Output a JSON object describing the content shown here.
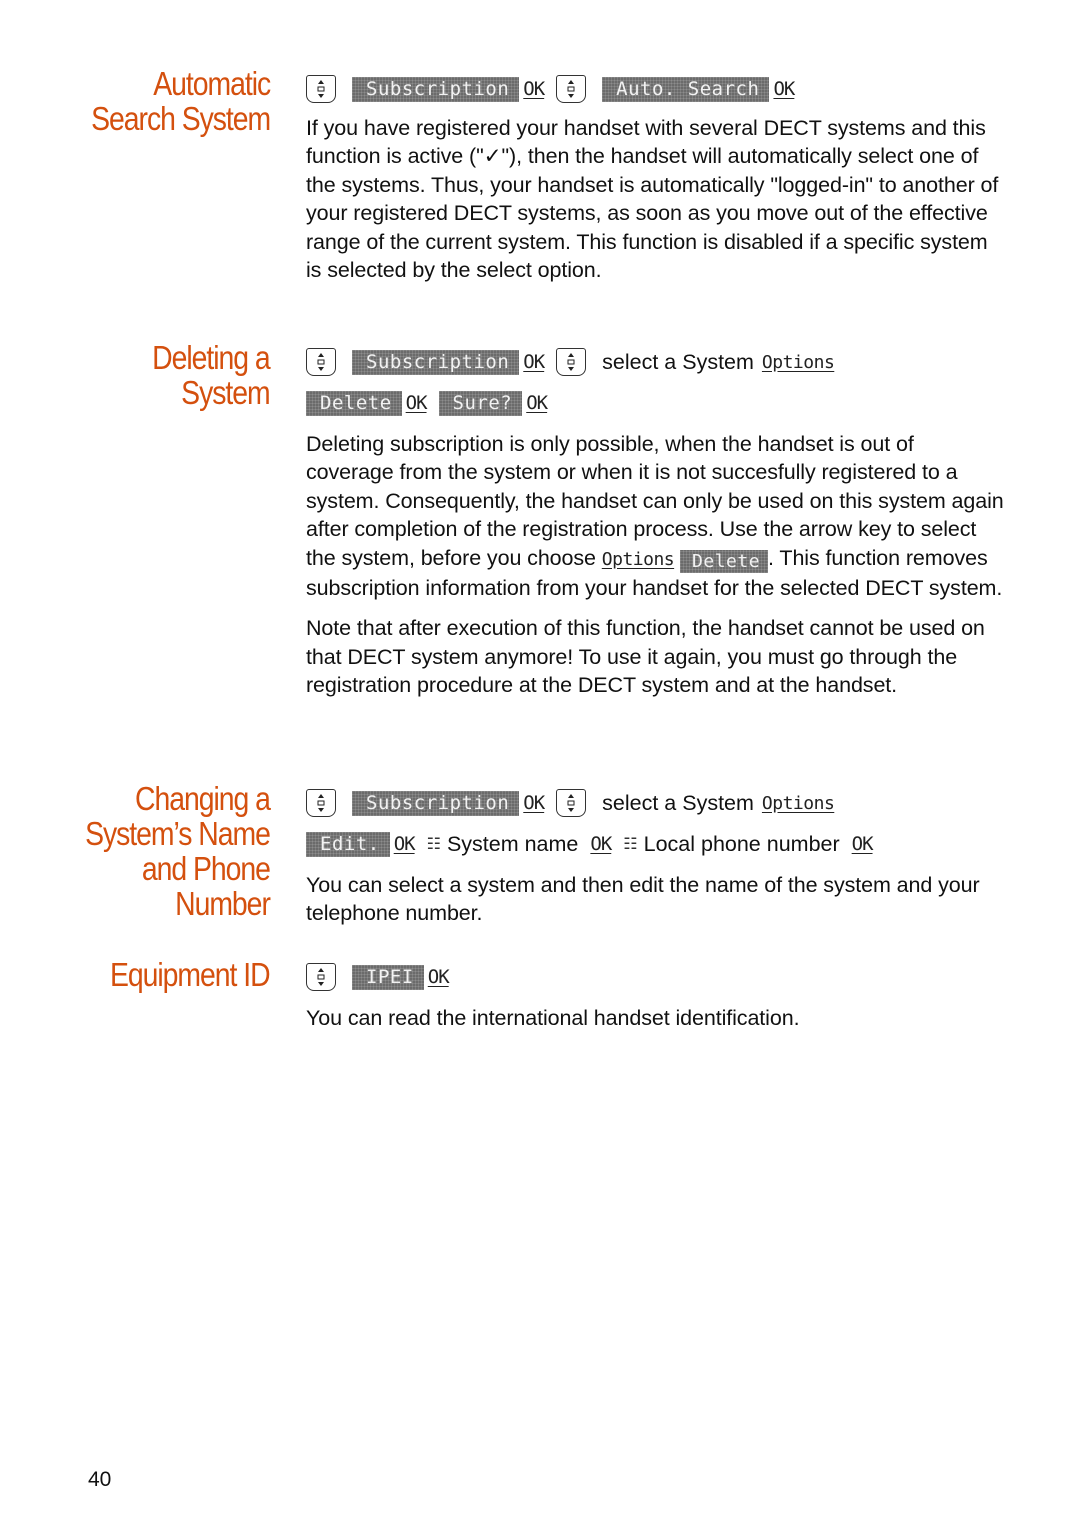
{
  "page_number": "40",
  "colors": {
    "heading": "#d4500e",
    "lcd_bg": "#6b6b6b",
    "text": "#111111"
  },
  "icons": {
    "nav_key": "updown-arrow-key-icon",
    "keypad": "keypad-hand-icon"
  },
  "sections": {
    "auto_search": {
      "title_line1": "Automatic",
      "title_line2": "Search System",
      "nav": {
        "lcd1": "Subscription",
        "ok1": "OK",
        "lcd2": "Auto. Search",
        "ok2": "OK"
      },
      "body": "If you have registered your handset with several DECT systems and this function is active (\"✓\"), then the handset will automatically select one of the systems. Thus, your handset is automatically \"logged-in\" to another of your registered DECT systems, as soon as you move out of the effective range of the current system. This function is disabled if a specific system is selected by the select option."
    },
    "deleting": {
      "title_line1": "Deleting a",
      "title_line2": "System",
      "nav": {
        "lcd1": "Subscription",
        "ok1": "OK",
        "select_text": "select a System",
        "options": "Options",
        "lcd2": "Delete",
        "ok2": "OK",
        "lcd3": "Sure?",
        "ok3": "OK"
      },
      "body1_a": "Deleting subscription is only possible, when the handset is out of coverage from the system or when it is not succesfully registered to a system. Consequently, the handset can only be used on this system again after completion of the registration process. Use the arrow key to select the system, before you choose",
      "body1_options": "Options",
      "body1_delete": "Delete",
      "body1_b": ". This function removes subscription information from your handset for the selected DECT system.",
      "body2": "Note that after execution of this function, the handset cannot be used on that DECT system anymore! To use it again, you must go through the registration procedure at the DECT system and at the handset."
    },
    "changing": {
      "title_line1": "Changing a",
      "title_line2": "System’s Name",
      "title_line3": "and Phone",
      "title_line4": "Number",
      "nav": {
        "lcd1": "Subscription",
        "ok1": "OK",
        "select_text": "select a System",
        "options": "Options",
        "lcd2": "Edit.",
        "ok2": "OK",
        "name_text": "System name",
        "ok3": "OK",
        "phone_text": "Local phone number",
        "ok4": "OK"
      },
      "body": "You can select a system and then edit the name of the system and your telephone number."
    },
    "equipment": {
      "title": "Equipment ID",
      "nav": {
        "lcd1": "IPEI",
        "ok1": "OK"
      },
      "body": "You can read the international handset identification."
    }
  }
}
